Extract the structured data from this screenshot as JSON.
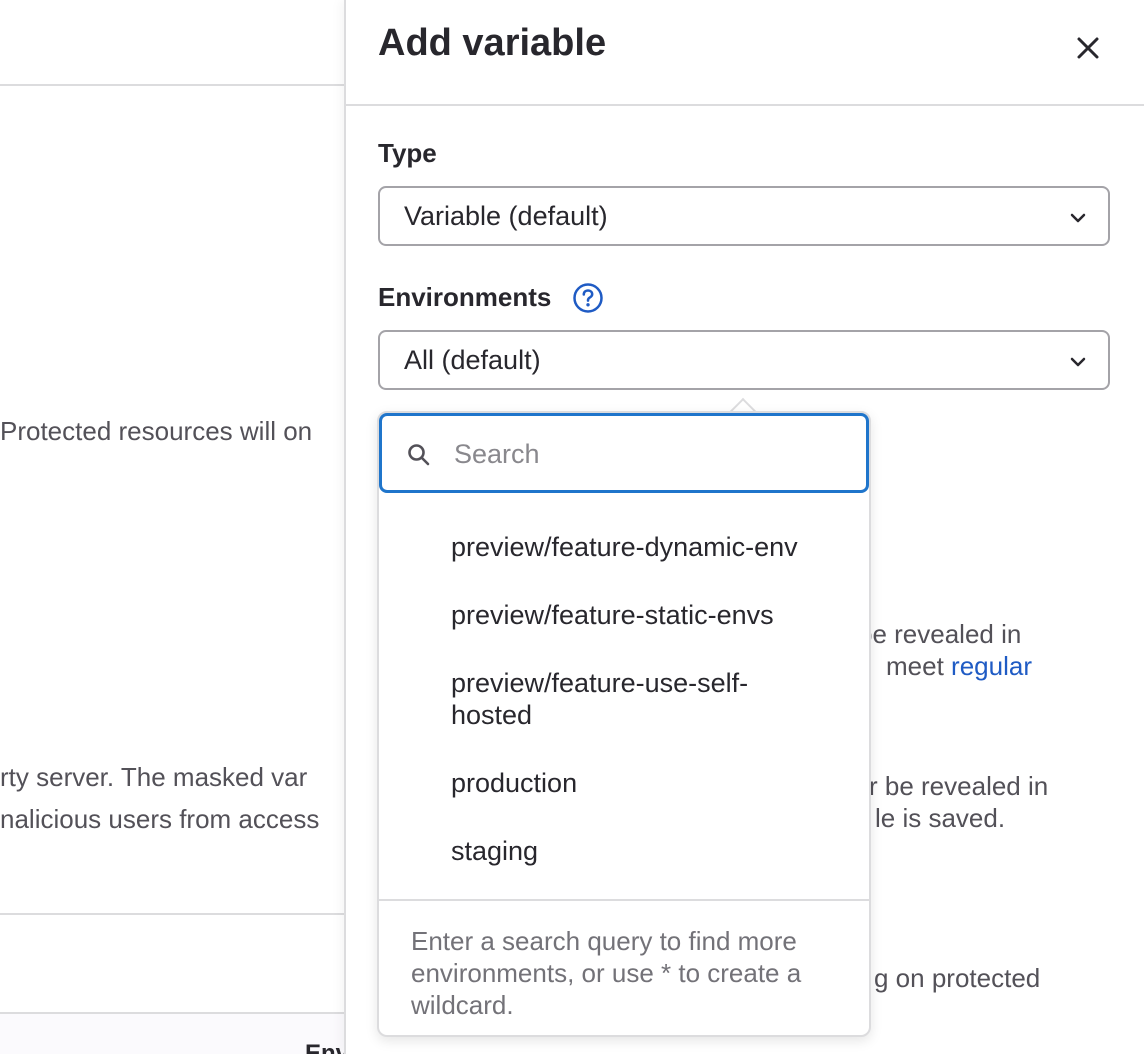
{
  "background": {
    "protected_text": "Protected resources will on",
    "masked_line1": "rty server. The masked var",
    "masked_line2": "nalicious users from access",
    "footer_header": "Env"
  },
  "drawer": {
    "title": "Add variable",
    "close_label": "×",
    "type": {
      "label": "Type",
      "value": "Variable (default)"
    },
    "environments": {
      "label": "Environments",
      "value": "All (default)"
    },
    "partial_texts": {
      "revealed1": "be revealed in",
      "meet": "meet",
      "regular_link": "regular",
      "revealed2": "r be revealed in",
      "saved": "le is saved.",
      "protected": "g on protected"
    }
  },
  "dropdown": {
    "search_placeholder": "Search",
    "search_value": "",
    "options": [
      {
        "label": "preview/feature-dynamic-env"
      },
      {
        "label": "preview/feature-static-envs"
      },
      {
        "label": "preview/feature-use-self-hosted"
      },
      {
        "label": "production"
      },
      {
        "label": "staging"
      }
    ],
    "footer_text": "Enter a search query to find more environments, or use * to create a wildcard."
  },
  "colors": {
    "accent": "#1f75cb",
    "link": "#1f5bc4",
    "border": "#dcdcde",
    "text": "#28272d"
  },
  "icons": {
    "close": "close-icon",
    "chevron": "chevron-down-icon",
    "help": "question-circle-icon",
    "search": "search-icon"
  }
}
